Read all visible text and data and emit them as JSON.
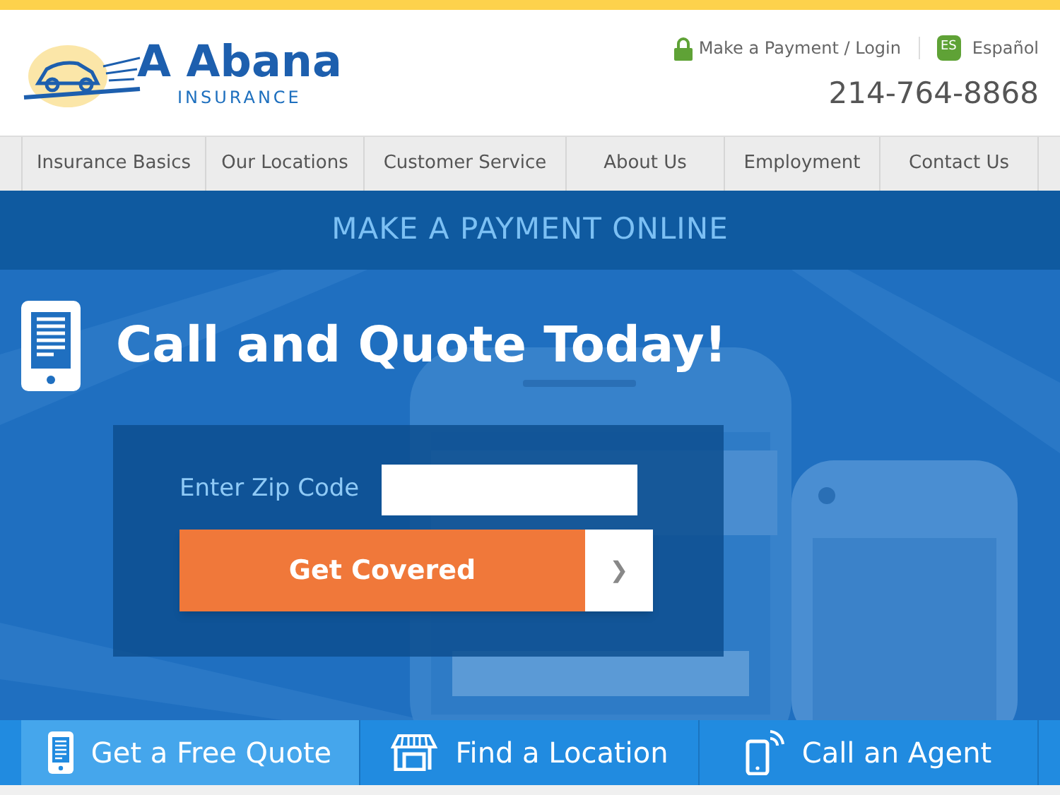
{
  "header": {
    "logo_title": "A Abana",
    "logo_subtitle": "INSURANCE",
    "payment_link": "Make a Payment / Login",
    "language_badge": "ES",
    "language_link": "Español",
    "phone": "214-764-8868"
  },
  "nav": [
    {
      "label": "Insurance Basics"
    },
    {
      "label": "Our Locations"
    },
    {
      "label": "Customer Service"
    },
    {
      "label": "About Us"
    },
    {
      "label": "Employment"
    },
    {
      "label": "Contact Us"
    }
  ],
  "banner": "MAKE A PAYMENT ONLINE",
  "hero": {
    "title": "Call and Quote Today!",
    "zip_label": "Enter Zip Code",
    "button": "Get Covered",
    "button_arrow": "❯"
  },
  "tabs": [
    {
      "label": "Get a Free Quote",
      "kind": "quote",
      "selected": true
    },
    {
      "label": "Find a Location",
      "kind": "location",
      "selected": false
    },
    {
      "label": "Call an Agent",
      "kind": "agent",
      "selected": false
    }
  ]
}
